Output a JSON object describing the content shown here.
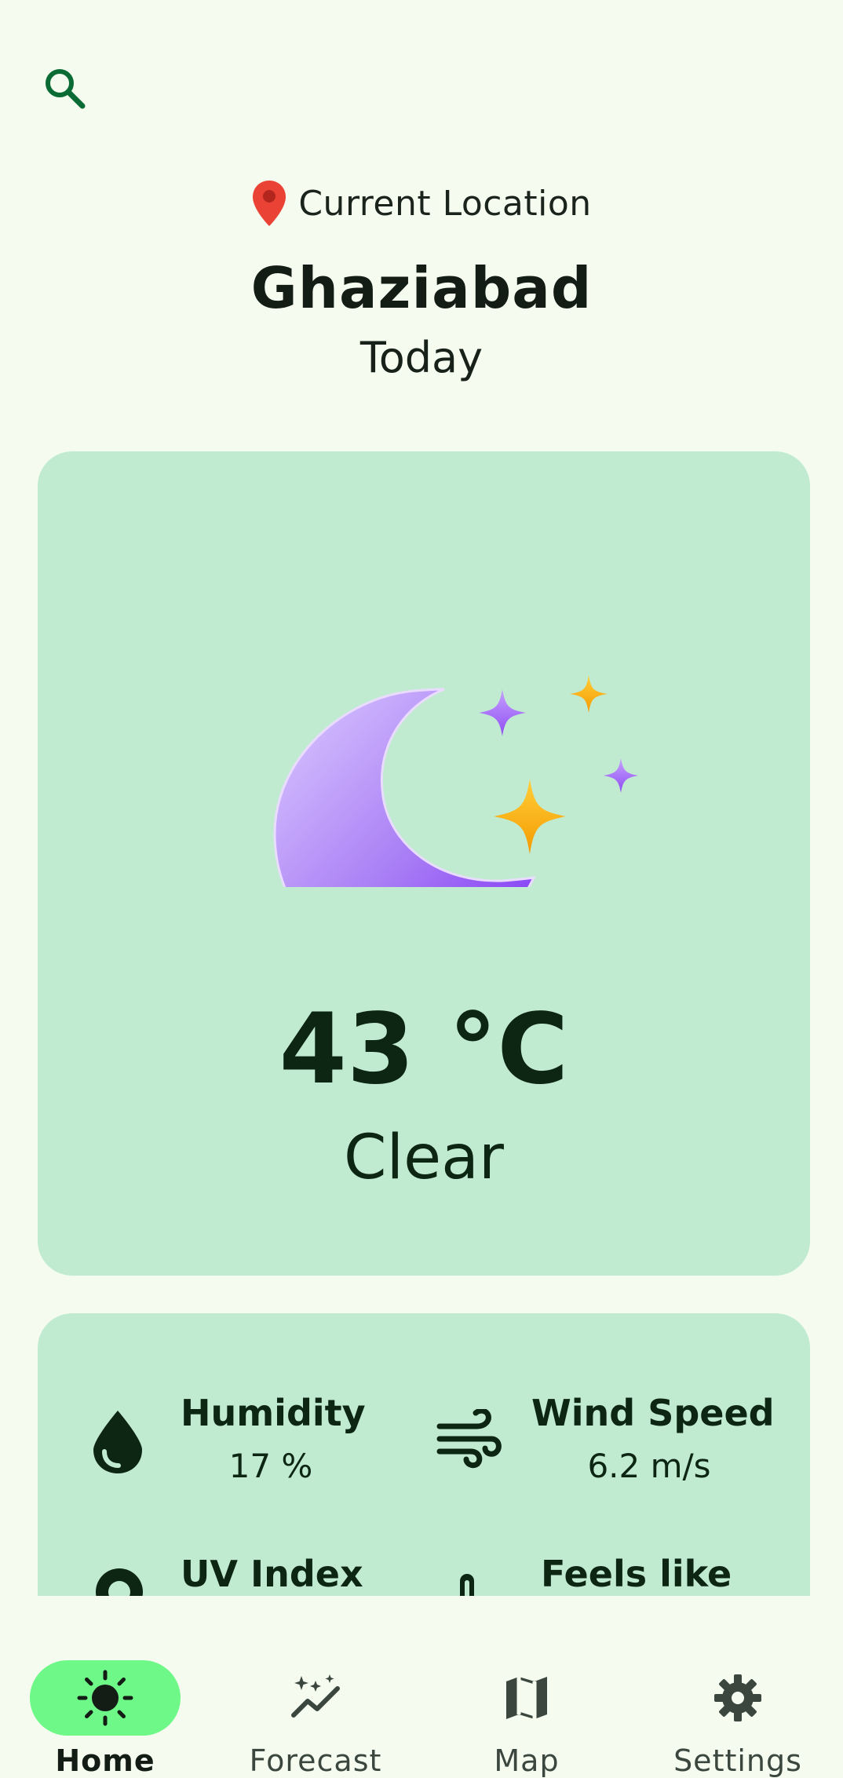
{
  "header": {
    "search_icon": "search-icon"
  },
  "location": {
    "label": "Current Location",
    "icon": "location-pin-icon",
    "city": "Ghaziabad",
    "day": "Today"
  },
  "current": {
    "icon": "clear-night-moon-stars-icon",
    "temperature": "43 °C",
    "condition": "Clear"
  },
  "details": [
    {
      "icon": "humidity-drop-icon",
      "label": "Humidity",
      "value": "17 %"
    },
    {
      "icon": "wind-icon",
      "label": "Wind Speed",
      "value": "6.2 m/s"
    },
    {
      "icon": "uv-sun-icon",
      "label": "UV Index",
      "value": ""
    },
    {
      "icon": "thermometer-icon",
      "label": "Feels like",
      "value": ""
    }
  ],
  "nav": [
    {
      "label": "Home",
      "icon": "sun-icon",
      "active": true
    },
    {
      "label": "Forecast",
      "icon": "sparkle-chart-icon",
      "active": false
    },
    {
      "label": "Map",
      "icon": "map-icon",
      "active": false
    },
    {
      "label": "Settings",
      "icon": "gear-icon",
      "active": false
    }
  ],
  "colors": {
    "background": "#f5fcef",
    "card": "#c1ebd1",
    "accent": "#6ef888",
    "primary_green": "#0b6b35",
    "pin_red": "#ea4335"
  }
}
